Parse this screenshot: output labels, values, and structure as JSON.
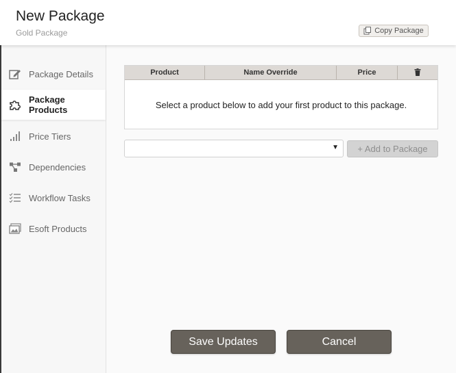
{
  "header": {
    "title": "New Package",
    "subtitle": "Gold Package",
    "copy_button_label": "Copy Package",
    "copy_icon": "copy-icon"
  },
  "sidebar": {
    "items": [
      {
        "label": "Package Details",
        "icon": "edit-icon",
        "active": false
      },
      {
        "label": "Package Products",
        "icon": "puzzle-icon",
        "active": true
      },
      {
        "label": "Price Tiers",
        "icon": "bar-chart-icon",
        "active": false
      },
      {
        "label": "Dependencies",
        "icon": "network-icon",
        "active": false
      },
      {
        "label": "Workflow Tasks",
        "icon": "checklist-icon",
        "active": false
      },
      {
        "label": "Esoft Products",
        "icon": "image-icon",
        "active": false
      }
    ]
  },
  "products_table": {
    "columns": [
      "Product",
      "Name Override",
      "Price"
    ],
    "delete_icon": "trash-icon",
    "empty_message": "Select a product below to add your first product to this package."
  },
  "product_select": {
    "value": ""
  },
  "add_button_label": "+ Add to Package",
  "footer": {
    "save_label": "Save Updates",
    "cancel_label": "Cancel"
  },
  "colors": {
    "primary_button": "#67625b",
    "table_header": "#ddd9d5",
    "sidebar_bg": "#f7f7f7"
  }
}
